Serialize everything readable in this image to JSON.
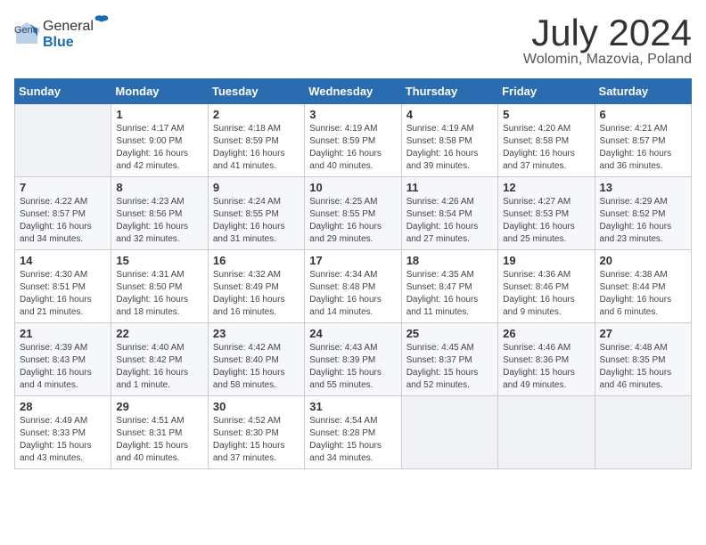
{
  "header": {
    "logo_general": "General",
    "logo_blue": "Blue",
    "month_title": "July 2024",
    "location": "Wolomin, Mazovia, Poland"
  },
  "weekdays": [
    "Sunday",
    "Monday",
    "Tuesday",
    "Wednesday",
    "Thursday",
    "Friday",
    "Saturday"
  ],
  "weeks": [
    [
      {
        "day": "",
        "info": ""
      },
      {
        "day": "1",
        "info": "Sunrise: 4:17 AM\nSunset: 9:00 PM\nDaylight: 16 hours\nand 42 minutes."
      },
      {
        "day": "2",
        "info": "Sunrise: 4:18 AM\nSunset: 8:59 PM\nDaylight: 16 hours\nand 41 minutes."
      },
      {
        "day": "3",
        "info": "Sunrise: 4:19 AM\nSunset: 8:59 PM\nDaylight: 16 hours\nand 40 minutes."
      },
      {
        "day": "4",
        "info": "Sunrise: 4:19 AM\nSunset: 8:58 PM\nDaylight: 16 hours\nand 39 minutes."
      },
      {
        "day": "5",
        "info": "Sunrise: 4:20 AM\nSunset: 8:58 PM\nDaylight: 16 hours\nand 37 minutes."
      },
      {
        "day": "6",
        "info": "Sunrise: 4:21 AM\nSunset: 8:57 PM\nDaylight: 16 hours\nand 36 minutes."
      }
    ],
    [
      {
        "day": "7",
        "info": "Sunrise: 4:22 AM\nSunset: 8:57 PM\nDaylight: 16 hours\nand 34 minutes."
      },
      {
        "day": "8",
        "info": "Sunrise: 4:23 AM\nSunset: 8:56 PM\nDaylight: 16 hours\nand 32 minutes."
      },
      {
        "day": "9",
        "info": "Sunrise: 4:24 AM\nSunset: 8:55 PM\nDaylight: 16 hours\nand 31 minutes."
      },
      {
        "day": "10",
        "info": "Sunrise: 4:25 AM\nSunset: 8:55 PM\nDaylight: 16 hours\nand 29 minutes."
      },
      {
        "day": "11",
        "info": "Sunrise: 4:26 AM\nSunset: 8:54 PM\nDaylight: 16 hours\nand 27 minutes."
      },
      {
        "day": "12",
        "info": "Sunrise: 4:27 AM\nSunset: 8:53 PM\nDaylight: 16 hours\nand 25 minutes."
      },
      {
        "day": "13",
        "info": "Sunrise: 4:29 AM\nSunset: 8:52 PM\nDaylight: 16 hours\nand 23 minutes."
      }
    ],
    [
      {
        "day": "14",
        "info": "Sunrise: 4:30 AM\nSunset: 8:51 PM\nDaylight: 16 hours\nand 21 minutes."
      },
      {
        "day": "15",
        "info": "Sunrise: 4:31 AM\nSunset: 8:50 PM\nDaylight: 16 hours\nand 18 minutes."
      },
      {
        "day": "16",
        "info": "Sunrise: 4:32 AM\nSunset: 8:49 PM\nDaylight: 16 hours\nand 16 minutes."
      },
      {
        "day": "17",
        "info": "Sunrise: 4:34 AM\nSunset: 8:48 PM\nDaylight: 16 hours\nand 14 minutes."
      },
      {
        "day": "18",
        "info": "Sunrise: 4:35 AM\nSunset: 8:47 PM\nDaylight: 16 hours\nand 11 minutes."
      },
      {
        "day": "19",
        "info": "Sunrise: 4:36 AM\nSunset: 8:46 PM\nDaylight: 16 hours\nand 9 minutes."
      },
      {
        "day": "20",
        "info": "Sunrise: 4:38 AM\nSunset: 8:44 PM\nDaylight: 16 hours\nand 6 minutes."
      }
    ],
    [
      {
        "day": "21",
        "info": "Sunrise: 4:39 AM\nSunset: 8:43 PM\nDaylight: 16 hours\nand 4 minutes."
      },
      {
        "day": "22",
        "info": "Sunrise: 4:40 AM\nSunset: 8:42 PM\nDaylight: 16 hours\nand 1 minute."
      },
      {
        "day": "23",
        "info": "Sunrise: 4:42 AM\nSunset: 8:40 PM\nDaylight: 15 hours\nand 58 minutes."
      },
      {
        "day": "24",
        "info": "Sunrise: 4:43 AM\nSunset: 8:39 PM\nDaylight: 15 hours\nand 55 minutes."
      },
      {
        "day": "25",
        "info": "Sunrise: 4:45 AM\nSunset: 8:37 PM\nDaylight: 15 hours\nand 52 minutes."
      },
      {
        "day": "26",
        "info": "Sunrise: 4:46 AM\nSunset: 8:36 PM\nDaylight: 15 hours\nand 49 minutes."
      },
      {
        "day": "27",
        "info": "Sunrise: 4:48 AM\nSunset: 8:35 PM\nDaylight: 15 hours\nand 46 minutes."
      }
    ],
    [
      {
        "day": "28",
        "info": "Sunrise: 4:49 AM\nSunset: 8:33 PM\nDaylight: 15 hours\nand 43 minutes."
      },
      {
        "day": "29",
        "info": "Sunrise: 4:51 AM\nSunset: 8:31 PM\nDaylight: 15 hours\nand 40 minutes."
      },
      {
        "day": "30",
        "info": "Sunrise: 4:52 AM\nSunset: 8:30 PM\nDaylight: 15 hours\nand 37 minutes."
      },
      {
        "day": "31",
        "info": "Sunrise: 4:54 AM\nSunset: 8:28 PM\nDaylight: 15 hours\nand 34 minutes."
      },
      {
        "day": "",
        "info": ""
      },
      {
        "day": "",
        "info": ""
      },
      {
        "day": "",
        "info": ""
      }
    ]
  ]
}
